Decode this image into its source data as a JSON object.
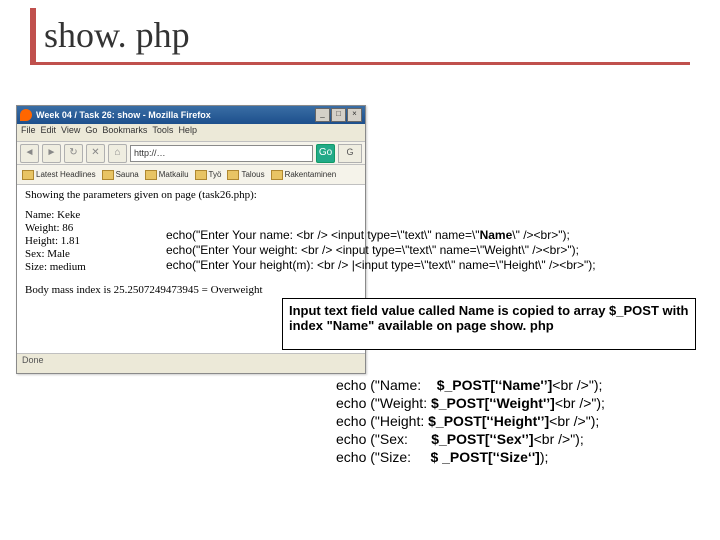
{
  "title": "show. php",
  "browser": {
    "window_title": "Week 04 / Task 26: show - Mozilla Firefox",
    "menu": [
      "File",
      "Edit",
      "View",
      "Go",
      "Bookmarks",
      "Tools",
      "Help"
    ],
    "url": "http://…",
    "go_label": "Go",
    "google_label": "G",
    "bookmarks": [
      "Latest Headlines",
      "Sauna",
      "Matkailu",
      "Työ",
      "Talous",
      "Rakentaminen"
    ],
    "content_heading": "Showing the parameters given on page (task26.php):",
    "rows": {
      "name": "Name: Keke",
      "weight": "Weight: 86",
      "height": "Height: 1.81",
      "sex": "Sex: Male",
      "size": "Size: medium"
    },
    "bmi": "Body mass index is 25.2507249473945 = Overweight",
    "status": "Done",
    "winbuttons": [
      "_",
      "□",
      "×"
    ]
  },
  "code_block_1": {
    "l1a": "echo(\"Enter Your name:    <br /> <input type=\\\"text\\\" name=\\\"",
    "l1b": "Name",
    "l1c": "\\\" /><br>\");",
    "l2": "echo(\"Enter Your weight: <br />  <input type=\\\"text\\\" name=\\\"Weight\\\" /><br>\");",
    "l3": "echo(\"Enter Your height(m): <br /> |<input type=\\\"text\\\" name=\\\"Height\\\" /><br>\");"
  },
  "annotation": {
    "t1": "Input text field value called Name is copied to array $_POST with index ",
    "t2": "\"Name\"",
    "t3": " available on page show. php"
  },
  "code_block_2": {
    "l1a": "echo (\"Name:    ",
    "l1b": "$_POST['‘Name'’]",
    "l1c": "<br />\");",
    "l2a": "echo (\"Weight: ",
    "l2b": "$_POST['‘Weight'’]",
    "l2c": "<br />\");",
    "l3a": "echo (\"Height: ",
    "l3b": "$_POST['‘Height'’]",
    "l3c": "<br />\");",
    "l4a": "echo (\"Sex:      ",
    "l4b": "$_POST['‘Sex'’]",
    "l4c": "<br />\");",
    "l5a": "echo (\"Size:     ",
    "l5b": "$ _POST['‘Size‘']",
    "l5c": ");"
  }
}
